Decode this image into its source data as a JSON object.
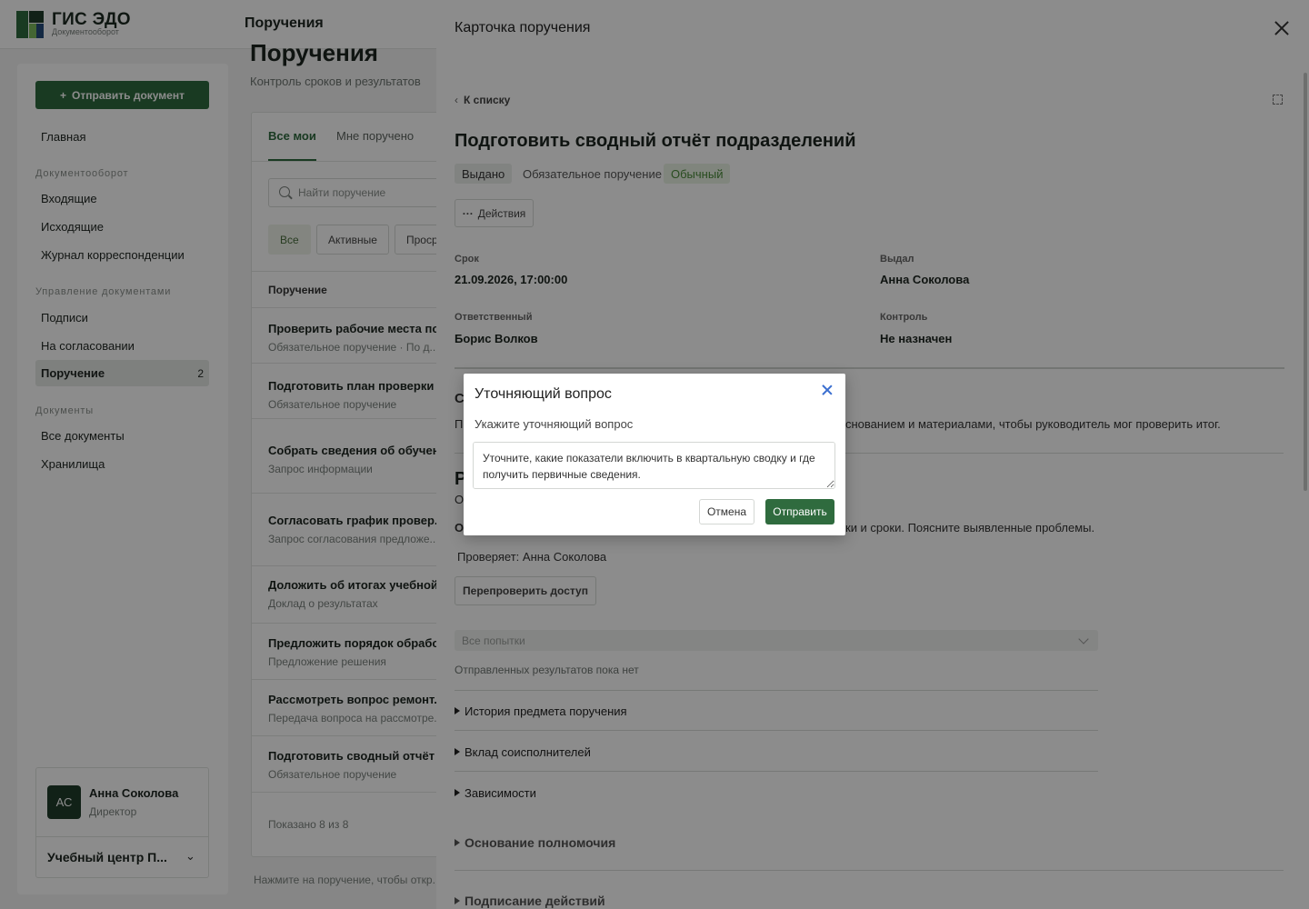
{
  "app": {
    "title": "ГИС ЭДО",
    "subtitle": "Документооборот",
    "page_header": "Поручения"
  },
  "colors": {
    "brand": "#2f6b3e",
    "link": "#3b6fd0"
  },
  "sidebar": {
    "send_button": "Отправить документ",
    "home": "Главная",
    "sections": [
      {
        "title": "Документооборот",
        "items": [
          "Входящие",
          "Исходящие",
          "Журнал корреспонденции"
        ]
      },
      {
        "title": "Управление документами",
        "items": [
          "Подписи",
          "На согласовании",
          "Поручение"
        ]
      },
      {
        "title": "Документы",
        "items": [
          "Все документы",
          "Хранилища"
        ]
      }
    ],
    "active_count": "2",
    "user": {
      "initials": "АС",
      "name": "Анна Соколова",
      "role": "Директор",
      "org": "Учебный центр П..."
    }
  },
  "list": {
    "title": "Поручения",
    "subtitle": "Контроль сроков и результатов",
    "tabs": [
      "Все мои",
      "Мне поручено"
    ],
    "search_placeholder": "Найти поручение",
    "filters": [
      "Все",
      "Активные",
      "Просроченные"
    ],
    "column": "Поручение",
    "rows": [
      {
        "title": "Проверить рабочие места по...",
        "meta": "Обязательное поручение · По д..."
      },
      {
        "title": "Подготовить план проверки ...",
        "meta": "Обязательное поручение"
      },
      {
        "title": "Собрать сведения об обучен...",
        "meta": "Запрос информации"
      },
      {
        "title": "Согласовать график провер...",
        "meta": "Запрос согласования предложе..."
      },
      {
        "title": "Доложить об итогах учебной...",
        "meta": "Доклад о результатах"
      },
      {
        "title": "Предложить порядок обрабо...",
        "meta": "Предложение решения"
      },
      {
        "title": "Рассмотреть вопрос ремонт...",
        "meta": "Передача вопроса на рассмотре..."
      },
      {
        "title": "Подготовить сводный отчёт ...",
        "meta": "Обязательное поручение"
      }
    ],
    "shown": "Показано 8 из 8",
    "hint": "Нажмите на поручение, чтобы откр..."
  },
  "drawer": {
    "title": "Карточка поручения",
    "back": "К списку",
    "task_title": "Подготовить сводный отчёт подразделений",
    "badges": [
      "Выдано",
      "Обязательное поручение",
      "Обычный"
    ],
    "actions": "Действия",
    "fields": [
      {
        "label": "Срок",
        "value": "21.09.2026, 17:00:00"
      },
      {
        "label": "Выдал",
        "value": "Анна Соколова"
      },
      {
        "label": "Ответственный",
        "value": "Борис Волков"
      },
      {
        "label": "Контроль",
        "value": "Не назначен"
      }
    ],
    "section_heading_fragment": "С",
    "desc_fragment_left": "П",
    "desc_fragment_right": "снованием и материалами, чтобы руководитель мог проверить итог.",
    "result_heading_fragment": "Р",
    "result_sub_fragment": "О",
    "result_bold_fragment": "О",
    "result_text_right": "ки и сроки. Поясните выявленные проблемы.",
    "reviewer": "Проверяет: Анна Соколова",
    "recheck_button": "Перепроверить доступ",
    "attempts_select": "Все попытки",
    "no_results": "Отправленных результатов пока нет",
    "collapsibles": [
      "История предмета поручения",
      "Вклад соисполнителей",
      "Зависимости"
    ],
    "sections_big": [
      "Основание полномочия",
      "Подписание действий"
    ]
  },
  "modal": {
    "title": "Уточняющий вопрос",
    "label": "Укажите уточняющий вопрос",
    "textarea_value": "Уточните, какие показатели включить в квартальную сводку и где получить первичные сведения.",
    "cancel": "Отмена",
    "submit": "Отправить"
  }
}
